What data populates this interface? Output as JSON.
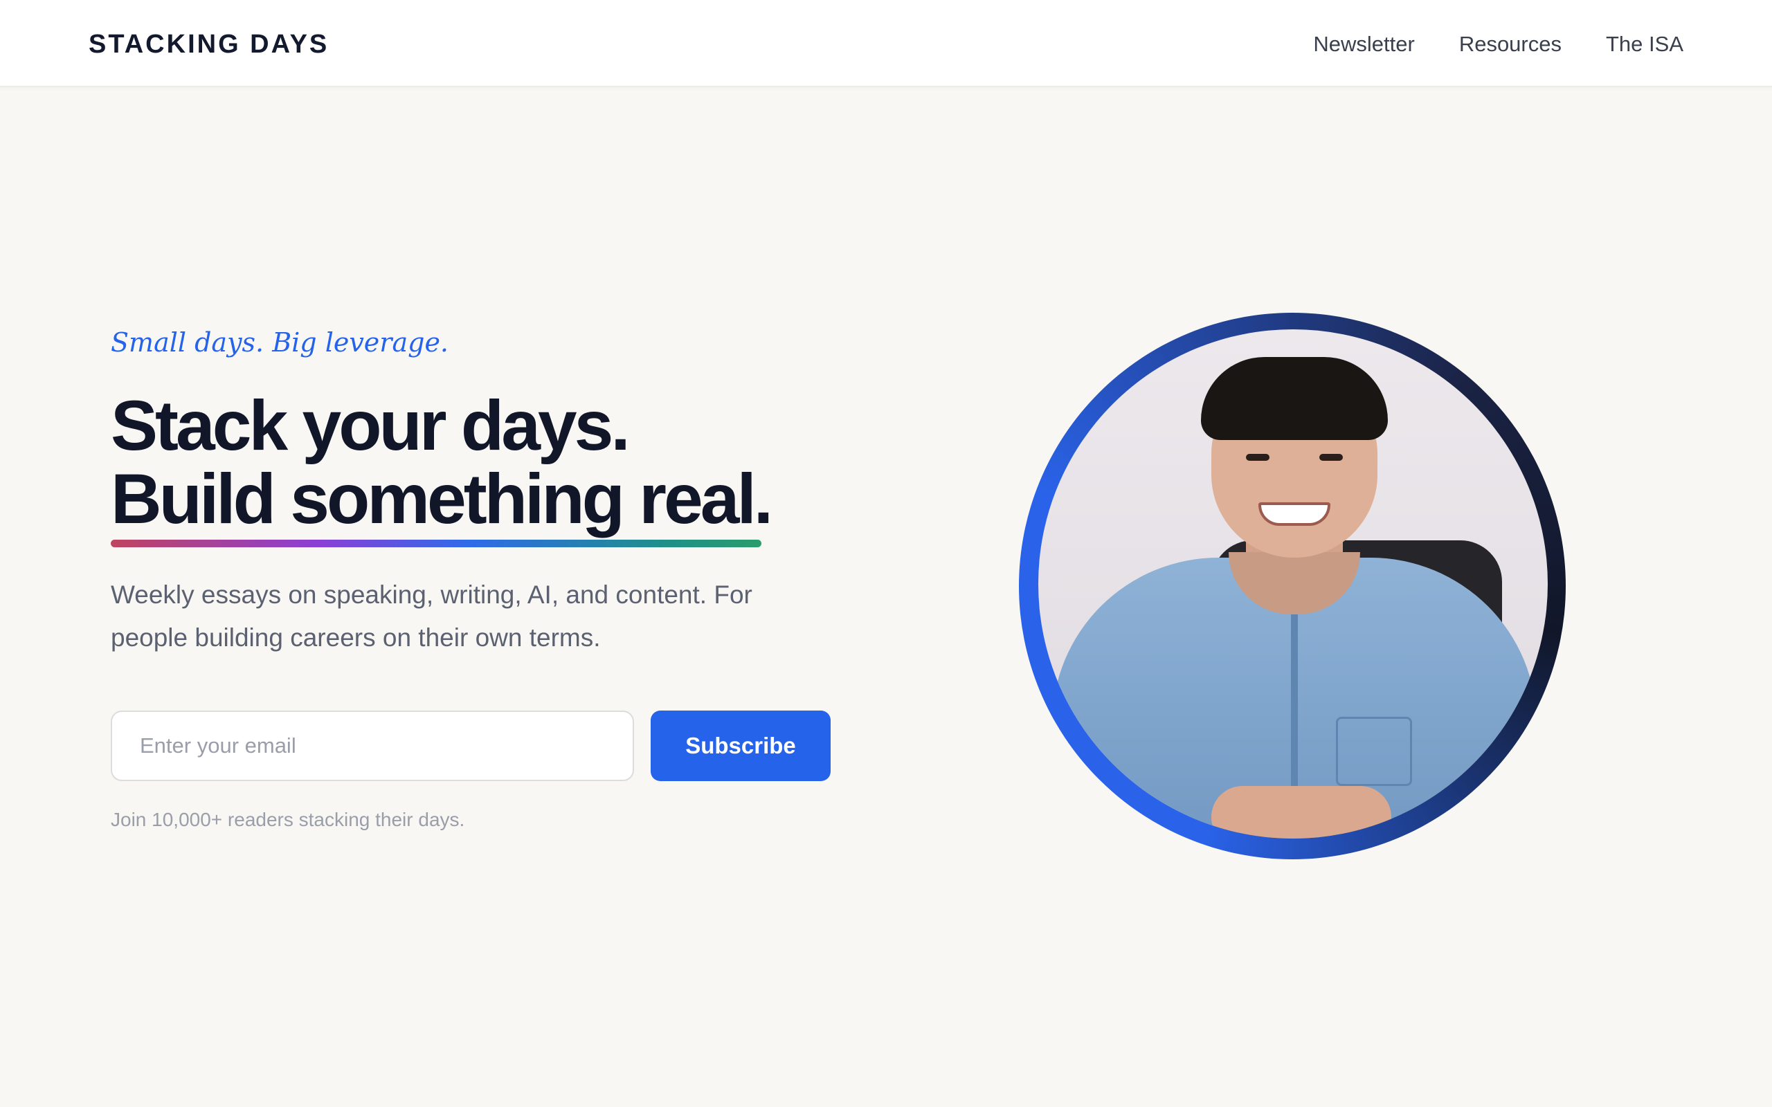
{
  "header": {
    "brand": "STACKING DAYS",
    "nav": [
      {
        "label": "Newsletter"
      },
      {
        "label": "Resources"
      },
      {
        "label": "The ISA"
      }
    ]
  },
  "hero": {
    "tagline": "Small days. Big leverage.",
    "headline_line1": "Stack your days.",
    "headline_line2": "Build something real.",
    "lede": "Weekly essays on speaking, writing, AI, and content. For people building careers on their own terms.",
    "email_placeholder": "Enter your email",
    "email_value": "",
    "subscribe_label": "Subscribe",
    "readers_note": "Join 10,000+ readers stacking their days."
  },
  "colors": {
    "accent": "#2563eb",
    "background": "#f8f7f4",
    "heading": "#111729"
  }
}
